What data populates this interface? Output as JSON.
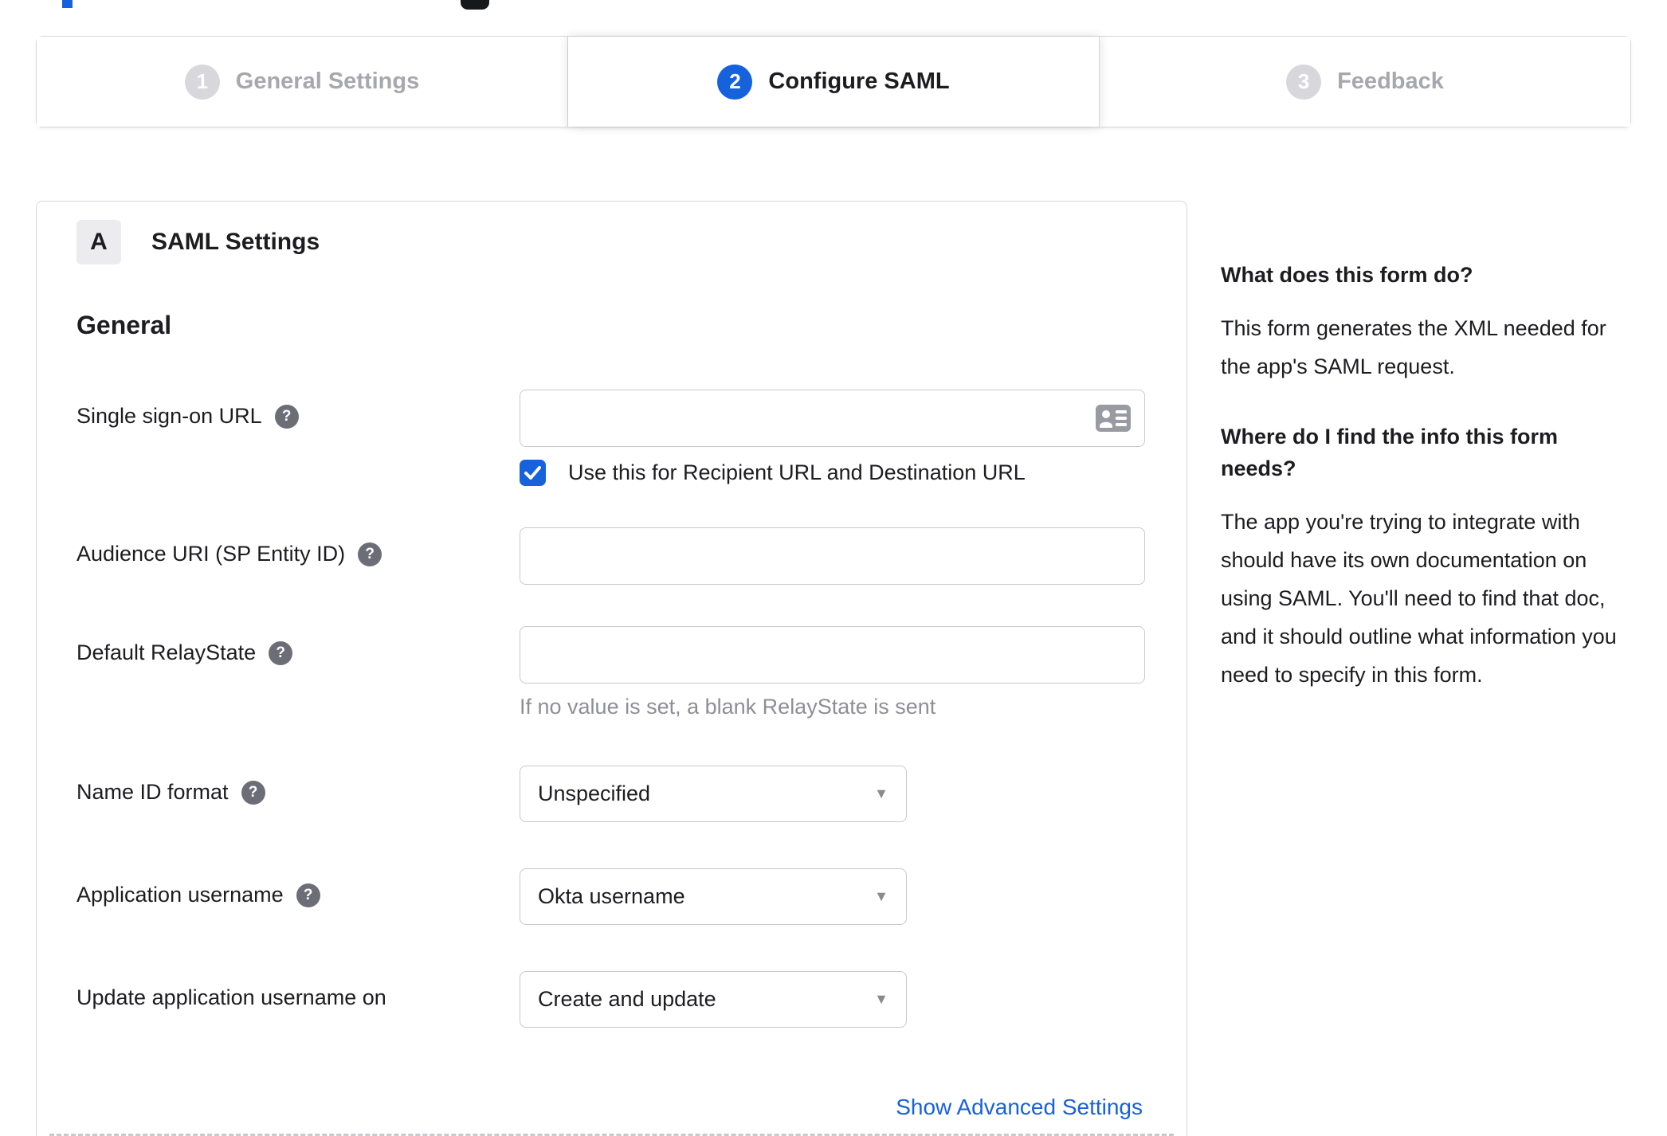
{
  "stepper": {
    "steps": [
      {
        "number": "1",
        "label": "General Settings",
        "state": "inactive"
      },
      {
        "number": "2",
        "label": "Configure SAML",
        "state": "active"
      },
      {
        "number": "3",
        "label": "Feedback",
        "state": "inactive"
      }
    ]
  },
  "panel": {
    "section_badge": "A",
    "section_title": "SAML Settings",
    "group_title": "General",
    "fields": {
      "sso": {
        "label": "Single sign-on URL",
        "value": "",
        "checkbox_label": "Use this for Recipient URL and Destination URL",
        "checkbox_checked": true
      },
      "audience": {
        "label": "Audience URI (SP Entity ID)",
        "value": ""
      },
      "relay": {
        "label": "Default RelayState",
        "value": "",
        "hint": "If no value is set, a blank RelayState is sent"
      },
      "nameid": {
        "label": "Name ID format",
        "value": "Unspecified"
      },
      "appuser": {
        "label": "Application username",
        "value": "Okta username"
      },
      "updateuser": {
        "label": "Update application username on",
        "value": "Create and update"
      }
    },
    "advanced_link": "Show Advanced Settings"
  },
  "sidebar": {
    "sections": [
      {
        "heading": "What does this form do?",
        "body": "This form generates the XML needed for the app's SAML request."
      },
      {
        "heading": "Where do I find the info this form needs?",
        "body": "The app you're trying to integrate with should have its own documentation on using SAML. You'll need to find that doc, and it should outline what information you need to specify in this form."
      }
    ]
  },
  "icons": {
    "help_glyph": "?",
    "caret_glyph": "▼"
  },
  "colors": {
    "accent_blue": "#1662dd",
    "inactive_gray": "#a7a7ae",
    "border_gray": "#d8d8dc",
    "hint_gray": "#8e8e96"
  }
}
